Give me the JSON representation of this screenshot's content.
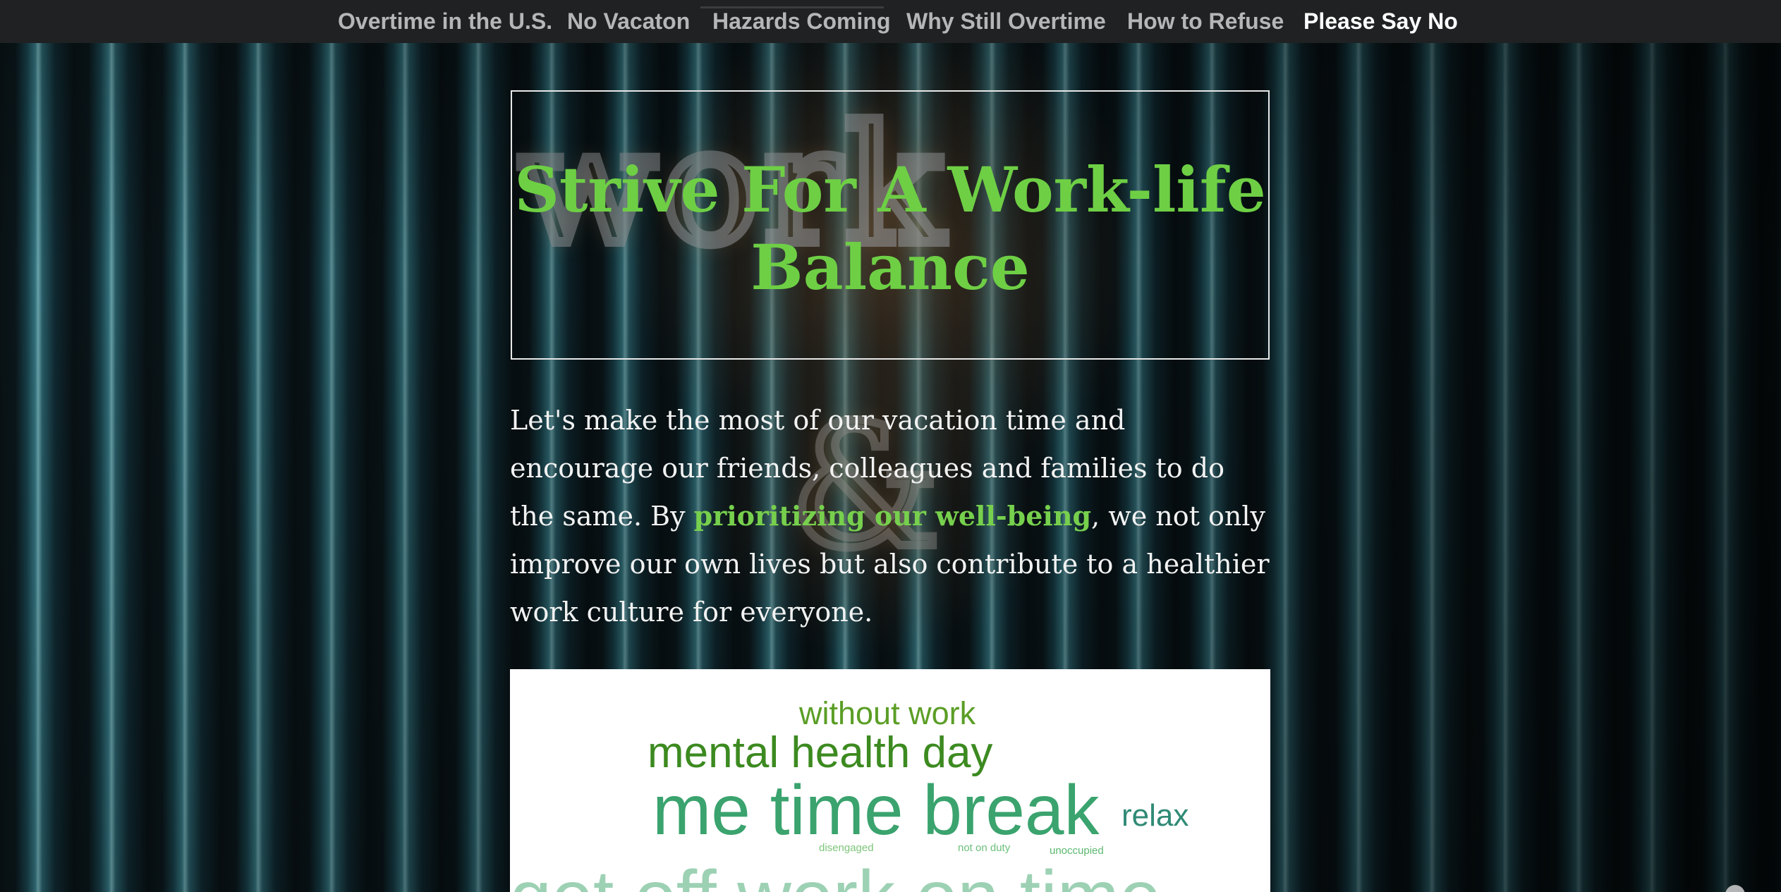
{
  "nav": {
    "items": [
      {
        "label": "Overtime in the U.S."
      },
      {
        "label": "No Vacaton"
      },
      {
        "label": "Hazards Coming"
      },
      {
        "label": "Why Still Overtime"
      },
      {
        "label": "How to Refuse"
      },
      {
        "label": "Please Say No"
      }
    ],
    "active": "Please Say No"
  },
  "background": {
    "neon_word": "work",
    "neon_ampersand": "&"
  },
  "hero": {
    "title": "Strive For A Work-life Balance"
  },
  "intro": {
    "text_before": "Let's make the most of our vacation time and encourage our friends, colleagues and families to do the same. By ",
    "highlight": "prioritizing our well-being",
    "text_after": ", we not only improve our own lives but also contribute to a healthier work culture for everyone."
  },
  "word_cloud": {
    "words": [
      {
        "text": "without work"
      },
      {
        "text": "mental health day"
      },
      {
        "text": "me time break"
      },
      {
        "text": "relax"
      },
      {
        "text": "disengaged"
      },
      {
        "text": "not on duty"
      },
      {
        "text": "unoccupied"
      },
      {
        "text": "get off work on time"
      }
    ]
  },
  "colors": {
    "accent_green": "#6ecf45",
    "nav_bg": "#1f2122",
    "nav_text": "#b4b6b8",
    "nav_active": "#ffffff",
    "body_text": "#f2f2f2"
  }
}
